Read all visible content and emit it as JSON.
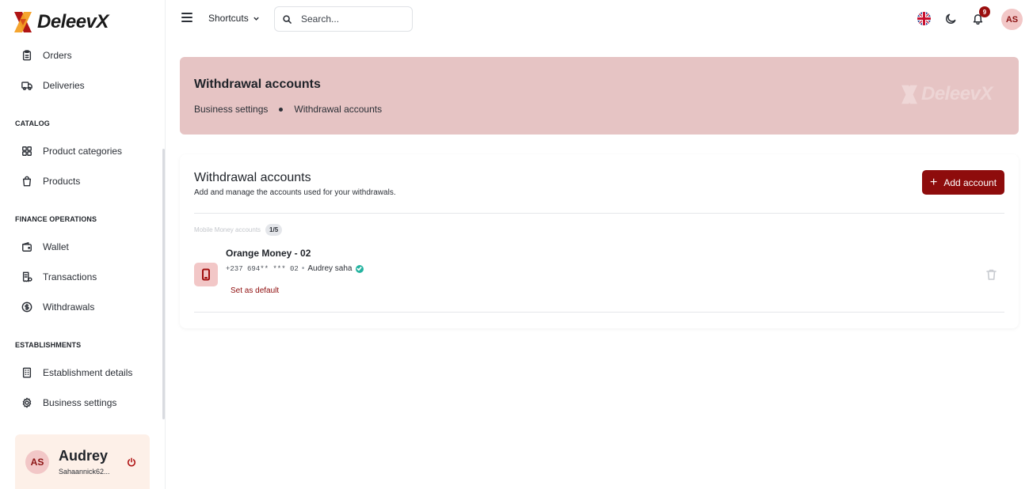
{
  "app": {
    "name": "DeleevX"
  },
  "sidebar": {
    "items_top": [
      {
        "label": "Orders",
        "icon": "clipboard-icon"
      },
      {
        "label": "Deliveries",
        "icon": "truck-icon"
      }
    ],
    "sections": [
      {
        "title": "CATALOG",
        "items": [
          {
            "label": "Product categories",
            "icon": "grid-icon"
          },
          {
            "label": "Products",
            "icon": "shopping-bag-icon"
          }
        ]
      },
      {
        "title": "FINANCE OPERATIONS",
        "items": [
          {
            "label": "Wallet",
            "icon": "wallet-icon"
          },
          {
            "label": "Transactions",
            "icon": "receipt-icon"
          },
          {
            "label": "Withdrawals",
            "icon": "dollar-circle-icon"
          }
        ]
      },
      {
        "title": "ESTABLISHMENTS",
        "items": [
          {
            "label": "Establishment details",
            "icon": "building-icon"
          },
          {
            "label": "Business settings",
            "icon": "gear-icon"
          }
        ]
      }
    ],
    "user": {
      "initials": "AS",
      "name": "Audrey",
      "email": "Sahaannick62..."
    }
  },
  "topbar": {
    "shortcuts_label": "Shortcuts",
    "search_placeholder": "Search...",
    "notifications_count": "9",
    "avatar_initials": "AS"
  },
  "banner": {
    "title": "Withdrawal accounts",
    "breadcrumb": [
      "Business settings",
      "Withdrawal accounts"
    ],
    "watermark": "DeleevX"
  },
  "card": {
    "title": "Withdrawal accounts",
    "subtitle": "Add and manage the accounts used for your withdrawals.",
    "add_button": "Add account",
    "group_label": "Mobile Money accounts",
    "group_count": "1/5",
    "accounts": [
      {
        "name": "Orange Money - 02",
        "number": "+237 694** *** 02",
        "holder": "Audrey saha",
        "set_default_label": "Set as default"
      }
    ]
  },
  "colors": {
    "brand": "#8e0c0c",
    "banner_bg": "#e6c4c4",
    "avatar_bg": "#f2c7c7",
    "verified": "#24b3a0",
    "logo_orange": "#f4a024",
    "logo_red": "#b01515"
  }
}
